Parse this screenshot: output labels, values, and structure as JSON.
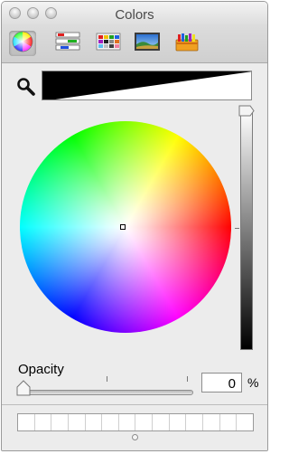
{
  "window": {
    "title": "Colors"
  },
  "toolbar": {
    "tabs": [
      {
        "icon": "color-wheel-icon",
        "selected": true
      },
      {
        "icon": "color-sliders-icon",
        "selected": false
      },
      {
        "icon": "color-palettes-icon",
        "selected": false
      },
      {
        "icon": "image-palettes-icon",
        "selected": false
      },
      {
        "icon": "crayons-icon",
        "selected": false
      }
    ]
  },
  "selected_color": "#000000",
  "opacity": {
    "label": "Opacity",
    "value": "0",
    "unit": "%"
  },
  "palette": {
    "swatch_count": 14
  }
}
